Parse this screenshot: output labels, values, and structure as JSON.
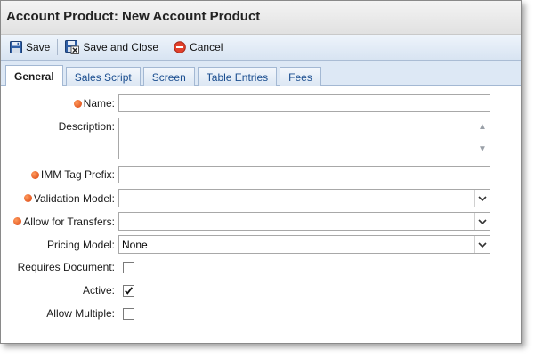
{
  "window": {
    "title": "Account Product: New Account Product"
  },
  "toolbar": {
    "save_label": "Save",
    "save_close_label": "Save and Close",
    "cancel_label": "Cancel"
  },
  "tabs": [
    {
      "label": "General",
      "active": true
    },
    {
      "label": "Sales Script",
      "active": false
    },
    {
      "label": "Screen",
      "active": false
    },
    {
      "label": "Table Entries",
      "active": false
    },
    {
      "label": "Fees",
      "active": false
    }
  ],
  "form": {
    "name": {
      "label": "Name:",
      "required": true,
      "value": ""
    },
    "description": {
      "label": "Description:",
      "required": false,
      "value": ""
    },
    "imm_tag_prefix": {
      "label": "IMM Tag Prefix:",
      "required": true,
      "value": ""
    },
    "validation_model": {
      "label": "Validation Model:",
      "required": true,
      "value": ""
    },
    "allow_for_transfers": {
      "label": "Allow for Transfers:",
      "required": true,
      "value": ""
    },
    "pricing_model": {
      "label": "Pricing Model:",
      "required": false,
      "value": "None"
    },
    "requires_document": {
      "label": "Requires Document:",
      "checked": false
    },
    "active": {
      "label": "Active:",
      "checked": true
    },
    "allow_multiple": {
      "label": "Allow Multiple:",
      "checked": false
    }
  },
  "colors": {
    "required_indicator": "#e0551a",
    "tab_text": "#1a4d8f",
    "toolbar_bg": "#dde8f5"
  },
  "icons": {
    "save": "floppy-disk-icon",
    "save_close": "floppy-disk-close-icon",
    "cancel": "cancel-icon",
    "dropdown": "chevron-down-icon"
  }
}
